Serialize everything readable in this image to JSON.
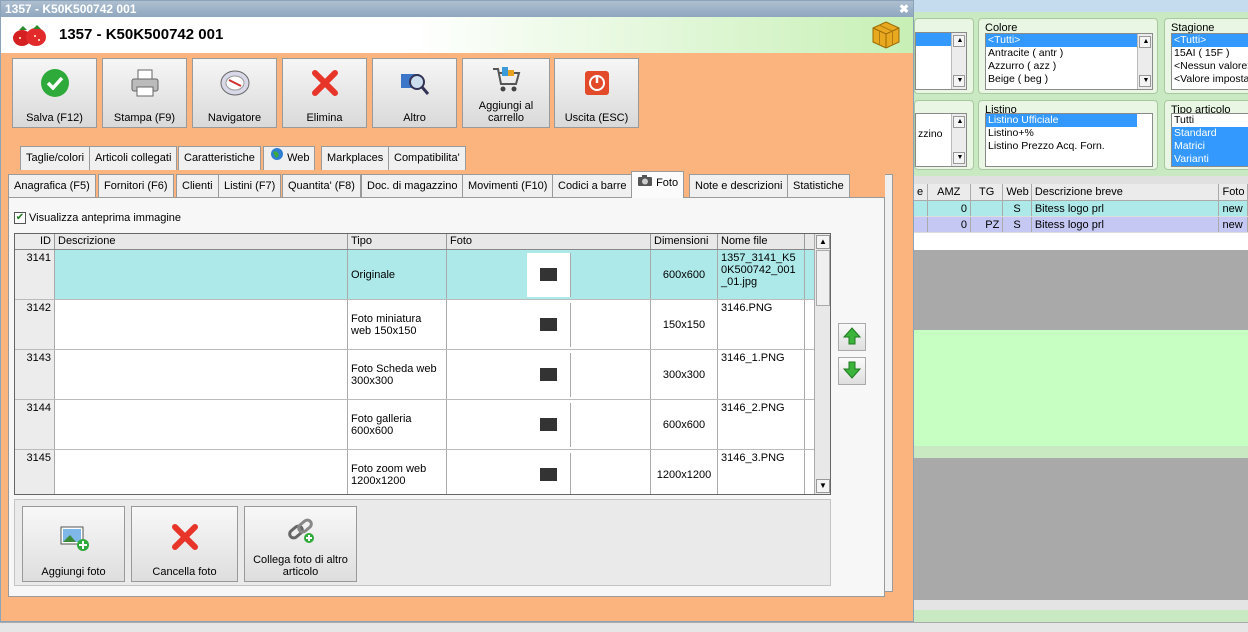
{
  "window": {
    "title": "1357 - K50K500742 001",
    "header_title": "1357 - K50K500742 001"
  },
  "toolbar": [
    {
      "label": "Salva (F12)",
      "icon": "check-icon"
    },
    {
      "label": "Stampa (F9)",
      "icon": "printer-icon"
    },
    {
      "label": "Navigatore",
      "icon": "compass-icon"
    },
    {
      "label": "Elimina",
      "icon": "delete-icon"
    },
    {
      "label": "Altro",
      "icon": "search-icon"
    },
    {
      "label": "Aggiungi al carrello",
      "icon": "cart-icon"
    },
    {
      "label": "Uscita (ESC)",
      "icon": "exit-icon"
    }
  ],
  "tabs_top": [
    "Taglie/colori",
    "Articoli collegati",
    "Caratteristiche",
    "Web",
    "Markplaces",
    "Compatibilita'"
  ],
  "tabs_bottom": [
    "Anagrafica (F5)",
    "Fornitori (F6)",
    "Clienti",
    "Listini (F7)",
    "Quantita' (F8)",
    "Doc. di magazzino",
    "Movimenti (F10)",
    "Codici a barre",
    "Foto",
    "Note e descrizioni",
    "Statistiche"
  ],
  "active_tab": "Foto",
  "preview_checkbox": {
    "label": "Visualizza anteprima immagine",
    "checked": true
  },
  "grid": {
    "headers": [
      "ID",
      "Descrizione",
      "Tipo",
      "Foto",
      "Dimensioni",
      "Nome file"
    ],
    "rows": [
      {
        "id": "3141",
        "desc": "",
        "tipo": "Originale",
        "dim": "600x600",
        "file": "1357_3141_K50K500742_001_01.jpg",
        "selected": true
      },
      {
        "id": "3142",
        "desc": "",
        "tipo": "Foto miniatura web 150x150",
        "dim": "150x150",
        "file": "3146.PNG",
        "selected": false
      },
      {
        "id": "3143",
        "desc": "",
        "tipo": "Foto Scheda web 300x300",
        "dim": "300x300",
        "file": "3146_1.PNG",
        "selected": false
      },
      {
        "id": "3144",
        "desc": "",
        "tipo": "Foto galleria 600x600",
        "dim": "600x600",
        "file": "3146_2.PNG",
        "selected": false
      },
      {
        "id": "3145",
        "desc": "",
        "tipo": "Foto zoom web 1200x1200",
        "dim": "1200x1200",
        "file": "3146_3.PNG",
        "selected": false
      }
    ]
  },
  "bottom_buttons": [
    {
      "label": "Aggiungi foto",
      "icon": "add-photo-icon"
    },
    {
      "label": "Cancella foto",
      "icon": "delete-icon"
    },
    {
      "label": "Collega foto di altro articolo",
      "icon": "link-icon"
    }
  ],
  "bg": {
    "colore": {
      "title": "Colore",
      "items": [
        "<Tutti>",
        "Antracite ( antr )",
        "Azzurro ( azz )",
        "Beige ( beg )"
      ],
      "selected": [
        0
      ]
    },
    "stagione": {
      "title": "Stagione",
      "items": [
        "<Tutti>",
        "15AI ( 15F )",
        "<Nessun valore>",
        "<Valore impostato>"
      ],
      "selected": [
        0
      ]
    },
    "listino": {
      "title": "Listino",
      "items": [
        "Listino Ufficiale",
        "Listino+%",
        "Listino Prezzo Acq. Forn."
      ],
      "selected": [
        0
      ]
    },
    "tipo_articolo": {
      "title": "Tipo articolo",
      "items": [
        "Tutti",
        "Standard",
        "Matrici",
        "Varianti"
      ],
      "selected": [
        1,
        2,
        3
      ]
    },
    "partial_text": "zzino",
    "grid_headers": [
      "e",
      "AMZ",
      "TG",
      "Web",
      "Descrizione breve",
      "Foto"
    ],
    "grid_rows": [
      [
        "",
        "0",
        "",
        "S",
        "Bitess logo prl",
        "new"
      ],
      [
        "",
        "0",
        "PZ",
        "S",
        "Bitess logo prl",
        "new"
      ]
    ]
  },
  "colors": {
    "window_bg": "#fcb47e",
    "selected_row": "#aee9ea",
    "bg_app": "#c9e9c3"
  }
}
